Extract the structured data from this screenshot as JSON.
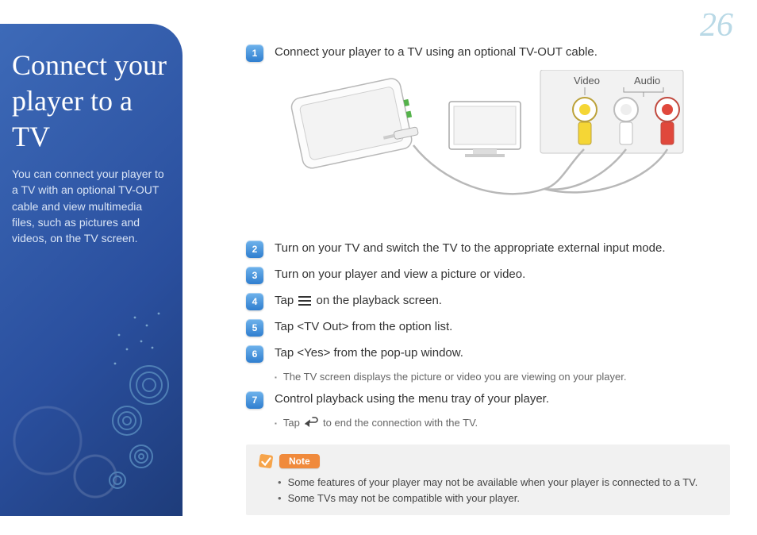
{
  "page_number": "26",
  "sidebar": {
    "title": "Connect your player to a TV",
    "description": "You can connect your player to a TV with an optional TV-OUT cable and view multimedia files, such as pictures and videos, on the TV screen."
  },
  "diagram": {
    "label_video": "Video",
    "label_audio": "Audio"
  },
  "steps": [
    {
      "num": "1",
      "text": "Connect your player to a TV using an optional TV-OUT cable."
    },
    {
      "num": "2",
      "text": "Turn on your TV and switch the TV to the appropriate external input mode."
    },
    {
      "num": "3",
      "text": "Turn on your player and view a picture or video."
    },
    {
      "num": "4",
      "text_before": "Tap ",
      "icon": "menu",
      "text_after": " on the playback screen."
    },
    {
      "num": "5",
      "text": "Tap <TV Out> from the option list."
    },
    {
      "num": "6",
      "text": "Tap <Yes> from the pop-up window.",
      "sub": "The TV screen displays the picture or video you are viewing on your player."
    },
    {
      "num": "7",
      "text": "Control playback using the menu tray of your player.",
      "sub_before": "Tap ",
      "sub_icon": "back",
      "sub_after": " to end the connection with the TV."
    }
  ],
  "note": {
    "label": "Note",
    "items": [
      "Some features of your player may not be available when your player is connected to a TV.",
      "Some TVs may not be compatible with your player."
    ]
  }
}
